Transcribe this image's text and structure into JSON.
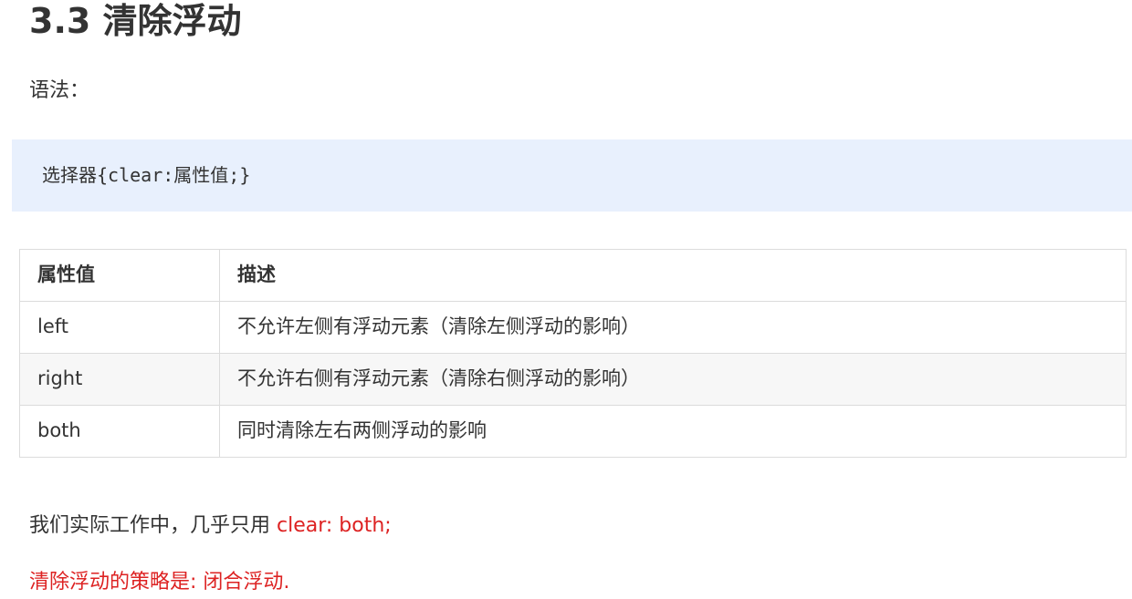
{
  "section": {
    "title": "3.3 清除浮动"
  },
  "syntax": {
    "label": "语法：",
    "code": "选择器{clear:属性值;}"
  },
  "table": {
    "headers": [
      "属性值",
      "描述"
    ],
    "rows": [
      {
        "value": "left",
        "desc": "不允许左侧有浮动元素（清除左侧浮动的影响）"
      },
      {
        "value": "right",
        "desc": "不允许右侧有浮动元素（清除右侧浮动的影响）"
      },
      {
        "value": "both",
        "desc": "同时清除左右两侧浮动的影响"
      }
    ]
  },
  "notes": {
    "practice_text": "我们实际工作中，几乎只用 ",
    "practice_highlight": "clear: both;",
    "strategy": "清除浮动的策略是: 闭合浮动."
  },
  "colors": {
    "highlight": "#dd2222",
    "code_background": "#e8f0fd"
  }
}
